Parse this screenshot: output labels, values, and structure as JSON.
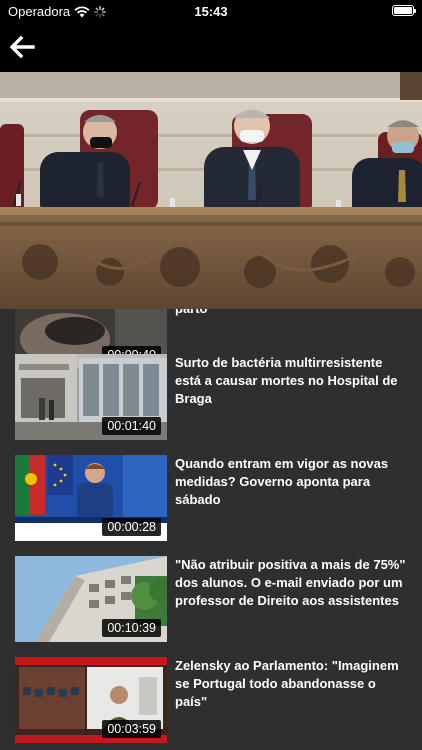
{
  "status_bar": {
    "carrier": "Operadora",
    "time": "15:43"
  },
  "nav": {
    "back_icon": "arrow-left-icon"
  },
  "player": {
    "scene": "parliament-video-frame"
  },
  "videos": [
    {
      "title": "parto",
      "duration": "00:00:40"
    },
    {
      "title": "Surto de bactéria multirresistente está a causar mortes no Hospital de Braga",
      "duration": "00:01:40"
    },
    {
      "title": "Quando entram em vigor as novas medidas? Governo aponta para sábado",
      "duration": "00:00:28"
    },
    {
      "title": "\"Não atribuir positiva a mais de 75%\" dos alunos. O e-mail enviado por um professor de Direito aos assistentes",
      "duration": "00:10:39"
    },
    {
      "title": "Zelensky ao Parlamento: \"Imaginem se Portugal todo abandonasse o país\"",
      "duration": "00:03:59"
    }
  ],
  "colors": {
    "background": "#2f2f2f",
    "bar": "#000000",
    "text": "#ffffff"
  }
}
